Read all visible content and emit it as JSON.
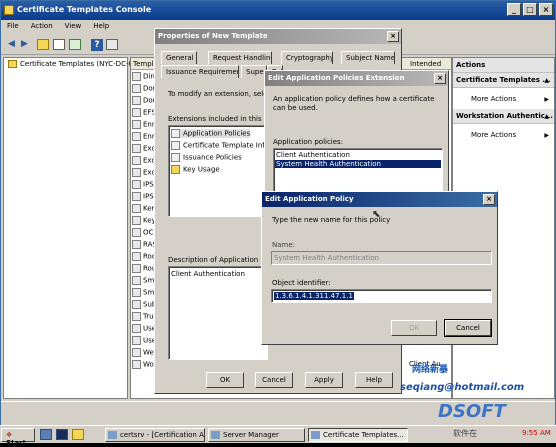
{
  "main_window": {
    "title": "Certificate Templates Console",
    "menu": [
      "File",
      "Action",
      "View",
      "Help"
    ],
    "toolbar_icons": [
      "back-arrow-icon",
      "forward-arrow-icon",
      "up-folder-icon",
      "show-hide-tree-icon",
      "export-list-icon",
      "properties-icon",
      "help-icon",
      "mmc-icon"
    ],
    "tree_root": "Certificate Templates (NYC-DC-01.",
    "list_header": {
      "col1": "Templat",
      "col2": "Intended"
    },
    "list_items": [
      "Dire",
      "Dom",
      "Dom",
      "EFS",
      "Enro",
      "Enro",
      "Exch",
      "Exch",
      "Exch",
      "IPSe",
      "IPSe",
      "Kerb",
      "Key",
      "OCS",
      "RAS",
      "Roo",
      "Rou",
      "Sma",
      "Sma",
      "Subo",
      "Trus",
      "User",
      "User",
      "Web",
      "Wor"
    ],
    "list_side_values": [
      "Client Au"
    ]
  },
  "actions": {
    "header": "Actions",
    "sections": [
      {
        "title": "Certificate Templates ...",
        "item": "More Actions"
      },
      {
        "title": "Workstation Authentic...",
        "item": "More Actions"
      }
    ]
  },
  "properties_dialog": {
    "title": "Properties of New Template",
    "tabs_row1": [
      "General",
      "Request Handling",
      "Cryptography",
      "Subject Name"
    ],
    "tabs_row2": [
      "Issuance Requirements",
      "Supers",
      "Extensions"
    ],
    "intro": "To modify an extension, select it,",
    "extensions_label": "Extensions included in this templa",
    "extensions": [
      "Application Policies",
      "Certificate Template Informati",
      "Issuance Policies",
      "Key Usage"
    ],
    "description_label": "Description of Application Policie",
    "description": "Client Authentication",
    "buttons": {
      "ok": "OK",
      "cancel": "Cancel",
      "apply": "Apply",
      "help": "Help"
    }
  },
  "extension_dialog": {
    "title": "Edit Application Policies Extension",
    "description": "An application policy defines how a certificate can be used.",
    "policies_label": "Application policies:",
    "policies": [
      "Client Authentication",
      "System Health Authentication"
    ],
    "selected_policy": "System Health Authentication"
  },
  "policy_dialog": {
    "title": "Edit Application Policy",
    "instruction": "Type the new name for this policy",
    "name_label": "Name:",
    "name_value": "System Health Authentication",
    "oid_label": "Object identifier:",
    "oid_value": "1.3.6.1.4.1.311.47.1.1",
    "ok": "OK",
    "cancel": "Cancel"
  },
  "taskbar": {
    "start": "Start",
    "tasks": [
      "certsrv - [Certification A...",
      "Server Manager",
      "Certificate Templates..."
    ],
    "active_task": "Certificate Templates...",
    "clock": "9:55 AM"
  },
  "watermark": {
    "line1": "网络新暴",
    "email": "seqiang@hotmail.com",
    "brand": "DSOFT",
    "brand_cn": "软件在"
  }
}
